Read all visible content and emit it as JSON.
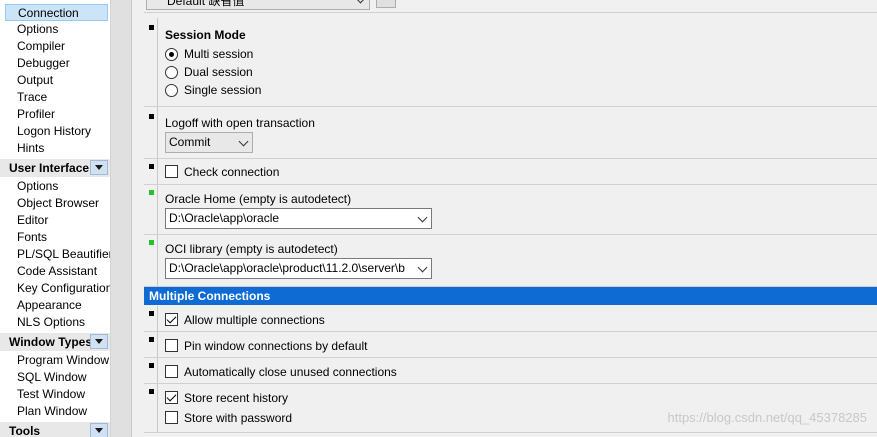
{
  "sidebar": {
    "items_top": [
      "Connection",
      "Options",
      "Compiler",
      "Debugger",
      "Output",
      "Trace",
      "Profiler",
      "Logon History",
      "Hints"
    ],
    "group_ui": "User Interface",
    "items_ui": [
      "Options",
      "Object Browser",
      "Editor",
      "Fonts",
      "PL/SQL Beautifier",
      "Code Assistant",
      "Key Configuration",
      "Appearance",
      "NLS Options"
    ],
    "group_window_types": "Window Types",
    "items_windows": [
      "Program Window",
      "SQL Window",
      "Test Window",
      "Plan Window"
    ],
    "group_tools": "Tools"
  },
  "session": {
    "title": "Session Mode",
    "options": [
      "Multi session",
      "Dual session",
      "Single session"
    ],
    "selected_index": 0
  },
  "logoff": {
    "label": "Logoff with open transaction",
    "value": "Commit"
  },
  "check_connection": {
    "label": "Check connection",
    "checked": false
  },
  "oracle_home": {
    "label": "Oracle Home (empty is autodetect)",
    "value": "D:\\Oracle\\app\\oracle"
  },
  "oci_library": {
    "label": "OCI library (empty is autodetect)",
    "value": "D:\\Oracle\\app\\oracle\\product\\11.2.0\\server\\b"
  },
  "multi": {
    "section_title": "Multiple Connections",
    "allow": {
      "label": "Allow multiple connections",
      "checked": true
    },
    "pin": {
      "label": "Pin window connections by default",
      "checked": false
    },
    "auto_close": {
      "label": "Automatically close unused connections",
      "checked": false
    },
    "store_recent": {
      "label": "Store recent history",
      "checked": true
    },
    "store_password": {
      "label": "Store with password",
      "checked": false
    }
  },
  "top_combo": {
    "value": "Default 缺省值"
  },
  "watermark": "https://blog.csdn.net/qq_45378285"
}
